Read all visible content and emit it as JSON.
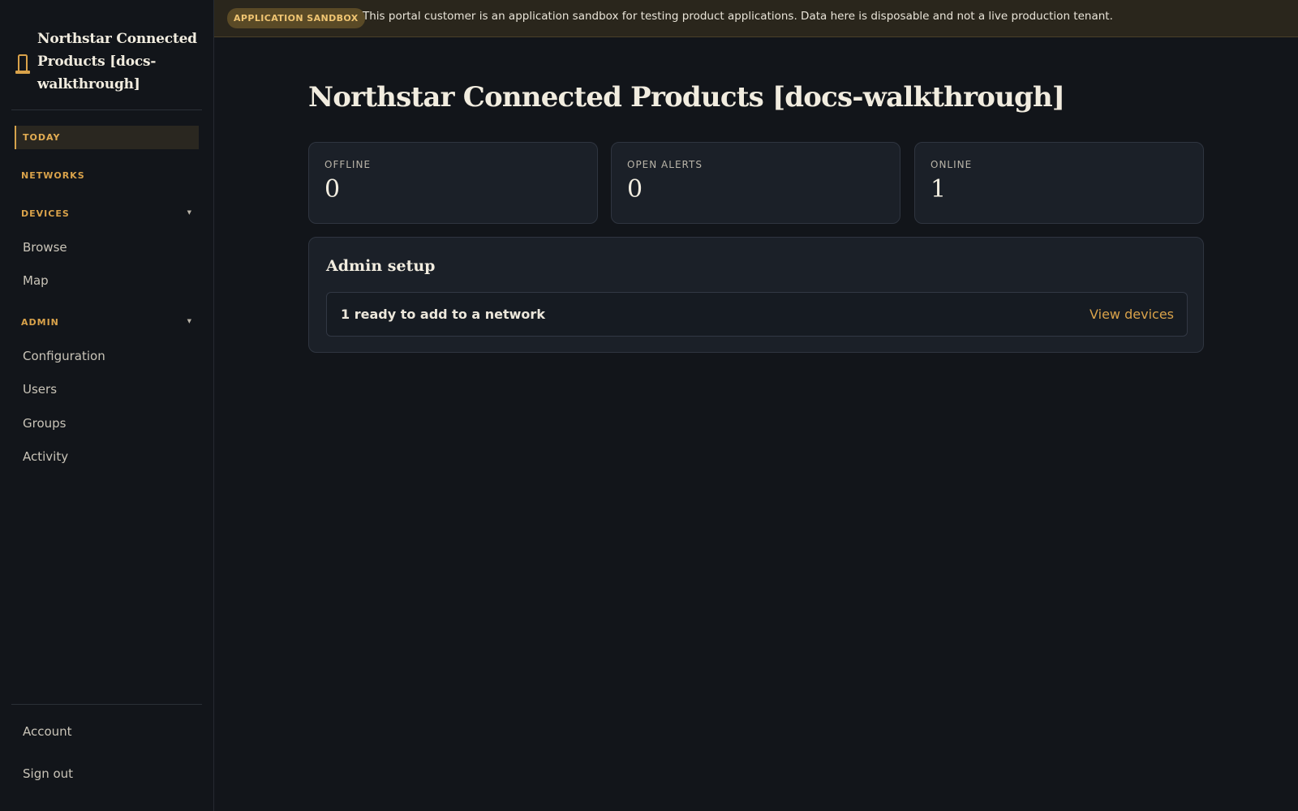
{
  "sidebar": {
    "brand_title": "Northstar Connected Products [docs-walkthrough]",
    "nav": {
      "today": "TODAY",
      "networks": "NETWORKS",
      "devices": "DEVICES",
      "devices_items": [
        "Browse",
        "Map"
      ],
      "admin": "ADMIN",
      "admin_items": [
        "Configuration",
        "Users",
        "Groups",
        "Activity"
      ]
    },
    "bottom": {
      "account": "Account",
      "sign_out": "Sign out"
    }
  },
  "banner": {
    "badge": "APPLICATION SANDBOX",
    "text": "This portal customer is an application sandbox for testing product applications. Data here is disposable and not a live production tenant."
  },
  "main": {
    "title": "Northstar Connected Products [docs-walkthrough]",
    "stats": [
      {
        "label": "OFFLINE",
        "value": "0"
      },
      {
        "label": "OPEN ALERTS",
        "value": "0"
      },
      {
        "label": "ONLINE",
        "value": "1"
      }
    ],
    "admin_setup": {
      "title": "Admin setup",
      "row_text": "1 ready to add to a network",
      "row_link": "View devices"
    }
  },
  "colors": {
    "accent": "#d9a24a",
    "background": "#12151a",
    "card": "#1b2028",
    "banner": "#2a261c"
  },
  "icons": {
    "brand": "device-icon",
    "collapse": "caret-down-icon"
  }
}
